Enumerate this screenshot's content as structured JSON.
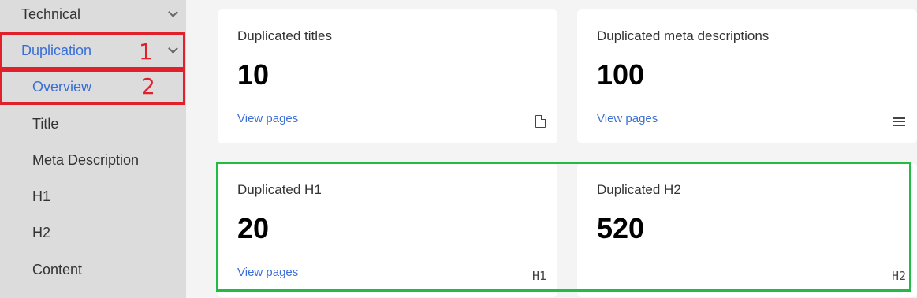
{
  "sidebar": {
    "items": [
      {
        "label": "Technical"
      },
      {
        "label": "Duplication"
      },
      {
        "label": "Overview"
      },
      {
        "label": "Title"
      },
      {
        "label": "Meta Description"
      },
      {
        "label": "H1"
      },
      {
        "label": "H2"
      },
      {
        "label": "Content"
      }
    ],
    "annotations": {
      "box1": "1",
      "box2": "2"
    }
  },
  "cards": [
    {
      "title": "Duplicated titles",
      "value": "10",
      "link": "View pages",
      "icon": "document-icon"
    },
    {
      "title": "Duplicated meta descriptions",
      "value": "100",
      "link": "View pages",
      "icon": "list-icon"
    },
    {
      "title": "Duplicated H1",
      "value": "20",
      "link": "View pages",
      "icon_text": "H1"
    },
    {
      "title": "Duplicated H2",
      "value": "520",
      "link": "",
      "icon_text": "H2"
    }
  ],
  "colors": {
    "accent": "#3b6fd8",
    "annotation_red": "#e0202a",
    "annotation_green": "#22bb44"
  }
}
